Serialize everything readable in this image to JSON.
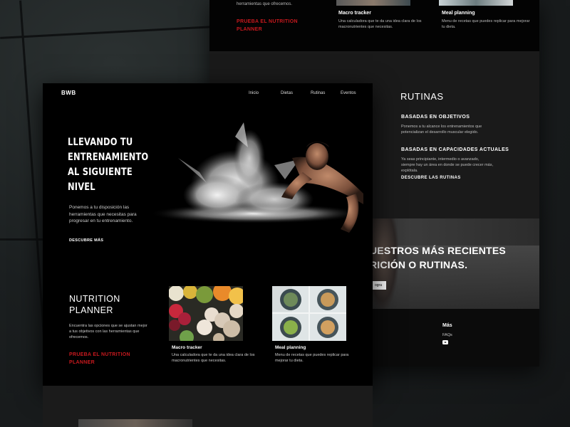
{
  "colors": {
    "background": "#1c1e1f",
    "page": "#000000",
    "accent_red": "#c8191e",
    "text_muted": "#cccccc"
  },
  "back_page": {
    "top": {
      "left_text": "herramientas que ofrecemos.",
      "cta": "PRUEBA EL NUTRITION PLANNER",
      "cards": [
        {
          "title": "Macro tracker",
          "desc": "Una calculadora que te da una idea clara de los macronutrientes que necesitas."
        },
        {
          "title": "Meal planning",
          "desc": "Menu de recetas que puedes replicar para mejorar tu dieta."
        }
      ]
    },
    "rutinas": {
      "title": "RUTINAS",
      "items": [
        {
          "title": "BASADAS EN OBJETIVOS",
          "desc": "Ponemos a tu alcance los entrenamientos que potencializan el desarrollo muscular elegido."
        },
        {
          "title": "BASADAS EN CAPACIDADES ACTUALES",
          "desc": "Ya seas principiante, intermedio o avanzado, siempre hay un área en donde se puede crecer más, explótala."
        }
      ],
      "link": "DESCUBRE LAS RUTINAS"
    },
    "hero2": {
      "line1": "UESTROS MÁS RECIENTES",
      "line2": "RICIÓN O RUTINAS.",
      "button": "ogra"
    },
    "footer": {
      "heading": "Más",
      "item": "FAQs",
      "youtube_icon": "youtube-icon",
      "left_a": "t",
      "left_b": "es"
    }
  },
  "front_page": {
    "logo": "BWB",
    "nav": [
      "Inicio",
      "Dietas",
      "Rutinas",
      "Eventos"
    ],
    "hero": {
      "title_lines": [
        "LLEVANDO TU",
        "ENTRENAMIENTO",
        "AL SIGUIENTE",
        "NIVEL"
      ],
      "desc": "Ponemos a tu disposición las herramientas que necesitas para progresar en tu entrenamiento.",
      "link": "DESCUBRE MÁS"
    },
    "nutrition": {
      "title": "NUTRITION PLANNER",
      "desc": "Encuentra las opciones que se ajustan mejor a tus objetivos con las herramientas que ofrecemos.",
      "cta": "PRUEBA EL NUTRITION PLANNER"
    },
    "cards": [
      {
        "title": "Macro tracker",
        "desc": "Una calculadora que te da una idea clara de los macronutrientes que necesitas."
      },
      {
        "title": "Meal planning",
        "desc": "Menu de recetas que puedes replicar para mejorar tu dieta."
      }
    ]
  }
}
